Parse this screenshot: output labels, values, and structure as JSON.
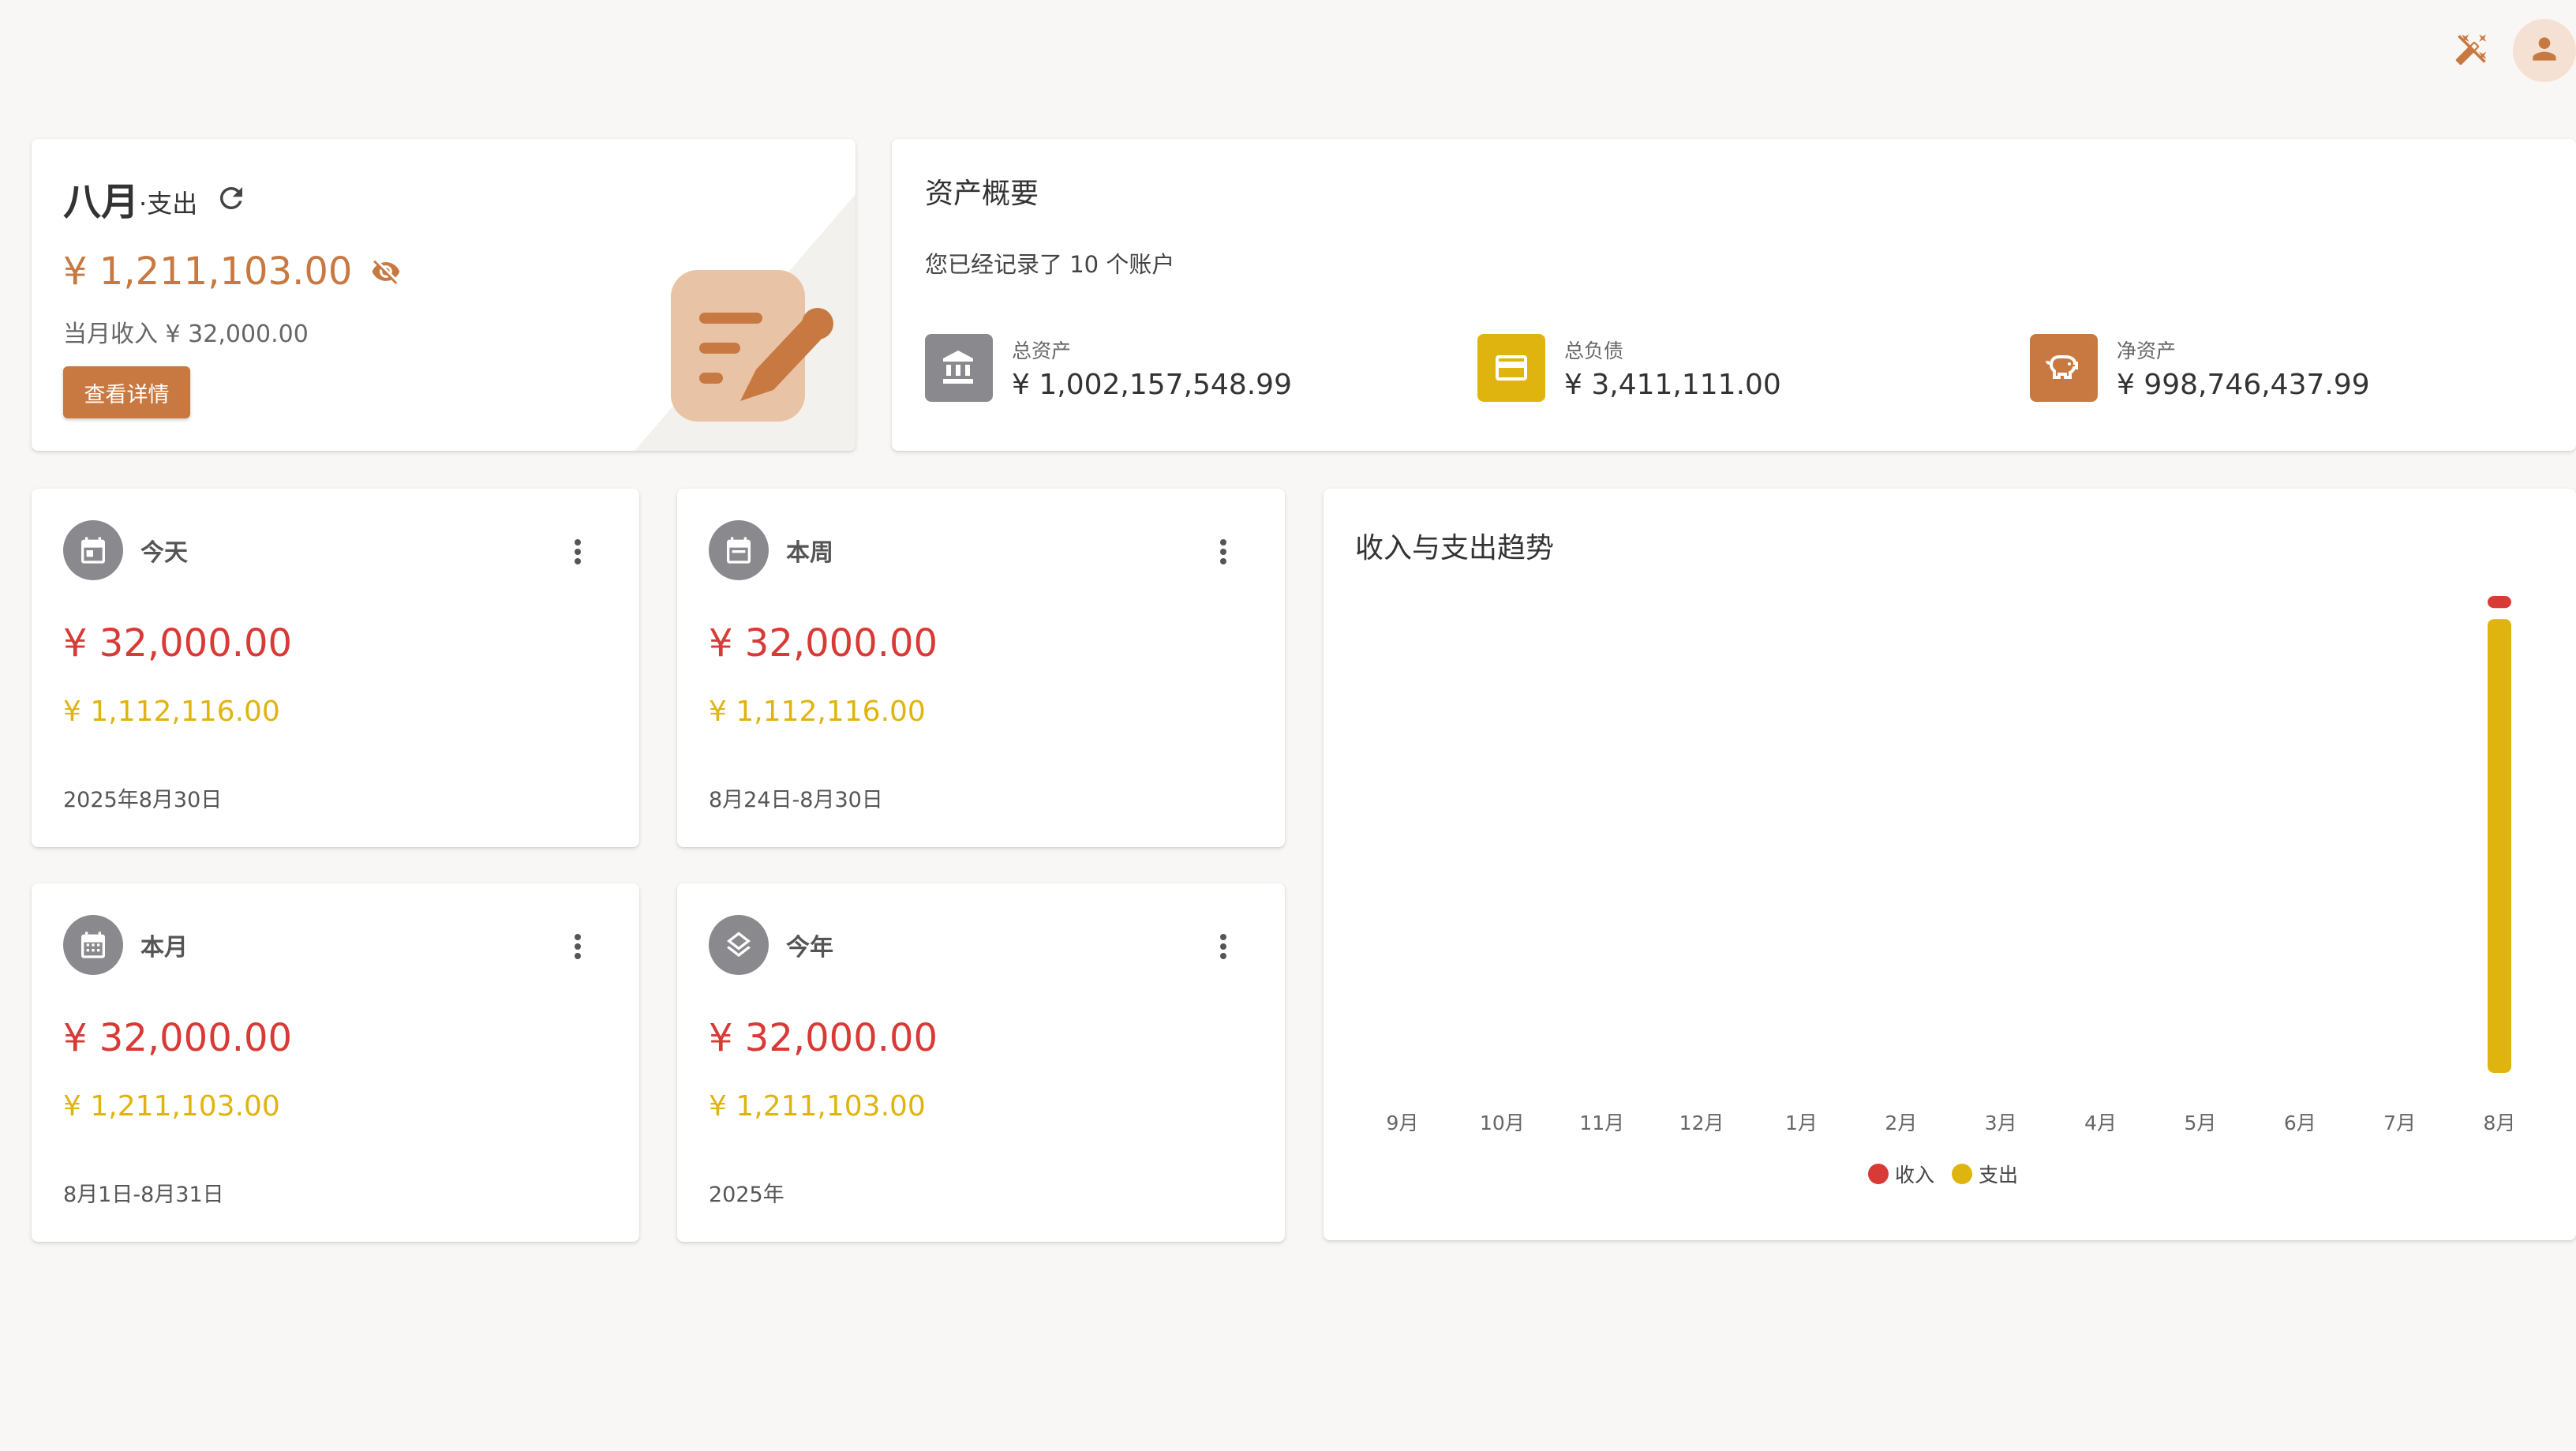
{
  "topbar": {
    "theme_icon": "theme-toggle-icon",
    "avatar_icon": "person-icon"
  },
  "month_card": {
    "title_big": "八月",
    "title_small": "·支出",
    "amount": "¥ 1,211,103.00",
    "income_text": "当月收入 ¥ 32,000.00",
    "detail_button": "查看详情"
  },
  "asset_overview": {
    "title": "资产概要",
    "subtitle": "您已经记录了 10 个账户",
    "items": [
      {
        "label": "总资产",
        "value": "¥ 1,002,157,548.99",
        "icon": "bank-icon",
        "color": "#8a8a8e"
      },
      {
        "label": "总负债",
        "value": "¥ 3,411,111.00",
        "icon": "credit-card-icon",
        "color": "#e0b40e"
      },
      {
        "label": "净资产",
        "value": "¥ 998,746,437.99",
        "icon": "piggy-bank-icon",
        "color": "#c87941"
      }
    ]
  },
  "stats": {
    "today": {
      "title": "今天",
      "income": "¥ 32,000.00",
      "expense": "¥ 1,112,116.00",
      "date": "2025年8月30日"
    },
    "week": {
      "title": "本周",
      "income": "¥ 32,000.00",
      "expense": "¥ 1,112,116.00",
      "date": "8月24日-8月30日"
    },
    "month": {
      "title": "本月",
      "income": "¥ 32,000.00",
      "expense": "¥ 1,211,103.00",
      "date": "8月1日-8月31日"
    },
    "year": {
      "title": "今年",
      "income": "¥ 32,000.00",
      "expense": "¥ 1,211,103.00",
      "date": "2025年"
    }
  },
  "colors": {
    "accent": "#c87941",
    "income": "#d83a36",
    "expense": "#e0b40e",
    "icon_gray": "#8a8a8e"
  },
  "chart_data": {
    "type": "bar",
    "title": "收入与支出趋势",
    "categories": [
      "9月",
      "10月",
      "11月",
      "12月",
      "1月",
      "2月",
      "3月",
      "4月",
      "5月",
      "6月",
      "7月",
      "8月"
    ],
    "series": [
      {
        "name": "收入",
        "color": "#d83a36",
        "values": [
          0,
          0,
          0,
          0,
          0,
          0,
          0,
          0,
          0,
          0,
          0,
          32000
        ]
      },
      {
        "name": "支出",
        "color": "#e0b40e",
        "values": [
          0,
          0,
          0,
          0,
          0,
          0,
          0,
          0,
          0,
          0,
          0,
          1211103
        ]
      }
    ],
    "stacked": true,
    "legend": "bottom",
    "grid": false
  }
}
